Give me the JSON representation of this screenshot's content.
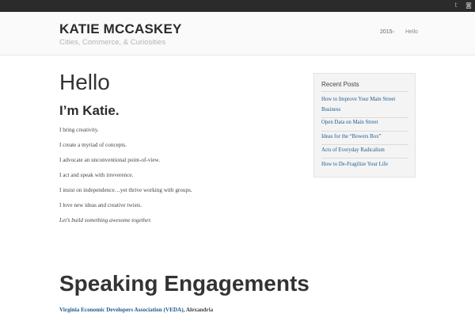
{
  "topbar": {
    "social": [
      {
        "icon": "twitter-icon",
        "glyph": "t"
      },
      {
        "icon": "instagram-icon",
        "glyph": "◙"
      }
    ]
  },
  "header": {
    "site_title": "KATIE MCCASKEY",
    "tagline": "Cities, Commerce, & Curiosities",
    "breadcrumb": {
      "year": "2015",
      "separator": ">",
      "current": "Hello"
    }
  },
  "main": {
    "title": "Hello",
    "subtitle": "I’m Katie.",
    "lines": [
      "I bring creativity.",
      "I create a myriad of concepts.",
      "I advocate an unconventional point-of-view.",
      "I act and speak with irreverence.",
      "I insist on independence…yet thrive working with groups.",
      "I love new ideas and creative twists.",
      "Let’s build something awesome together."
    ],
    "speaking_title": "Speaking Engagements",
    "speaking_first": {
      "link": "Virginia Economic Developers Association (VEDA)",
      "place": ", Alexandria"
    }
  },
  "sidebar": {
    "widget_title": "Recent Posts",
    "posts": [
      "How to Improve Your Main Street Business",
      "Open Data on Main Street",
      "Ideas for the “Bowers Box”",
      "Acts of Everyday Radicalism",
      "How to De-Fragilize Your Life"
    ]
  },
  "colors": {
    "topbar": "#2b2b2b",
    "header_bg": "#fafafa",
    "link": "#1d5a8c",
    "widget_bg": "#f4f4f4"
  }
}
